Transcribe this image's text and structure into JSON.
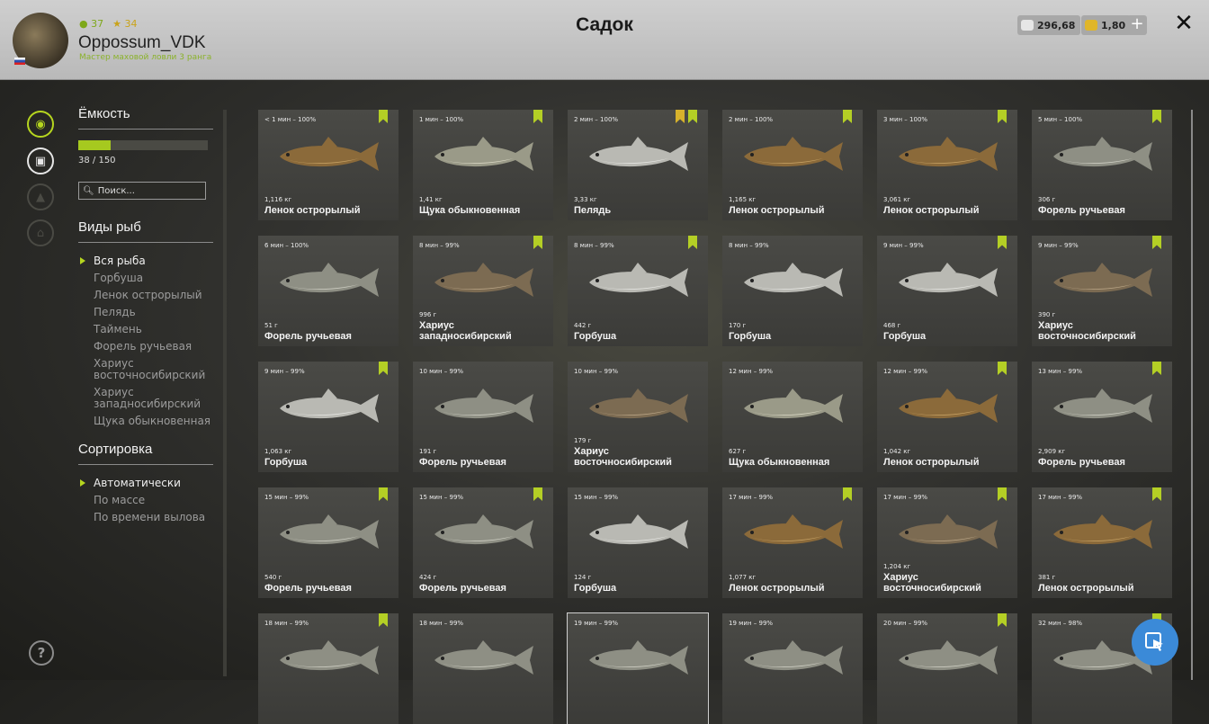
{
  "header": {
    "title": "Садок",
    "username": "Oppossum_VDK",
    "rank_text": "Мастер маховой ловли 3 ранга",
    "level_green": "37",
    "level_gold": "34",
    "silver": "296,68",
    "gold": "1,80",
    "plus_label": "+",
    "close_label": "✕"
  },
  "capacity": {
    "title": "Ёмкость",
    "text": "38 / 150",
    "fraction": 0.2533
  },
  "search": {
    "placeholder": "Поиск..."
  },
  "species": {
    "title": "Виды рыб",
    "items": [
      "Вся рыба",
      "Горбуша",
      "Ленок острорылый",
      "Пелядь",
      "Таймень",
      "Форель ручьевая",
      "Хариус восточносибирский",
      "Хариус западносибирский",
      "Щука обыкновенная"
    ]
  },
  "sorting": {
    "title": "Сортировка",
    "items": [
      "Автоматически",
      "По массе",
      "По времени вылова"
    ]
  },
  "help_label": "?",
  "colors": {
    "accent": "#b6d61f",
    "fab": "#3b8ad8"
  },
  "fish": [
    {
      "time": "< 1 мин – 100%",
      "mass": "1,116 кг",
      "name": "Ленок острорылый",
      "tags": 1
    },
    {
      "time": "1 мин – 100%",
      "mass": "1,41 кг",
      "name": "Щука обыкновенная",
      "tags": 1
    },
    {
      "time": "2 мин – 100%",
      "mass": "3,33 кг",
      "name": "Пелядь",
      "tags": 2
    },
    {
      "time": "2 мин – 100%",
      "mass": "1,165 кг",
      "name": "Ленок острорылый",
      "tags": 1
    },
    {
      "time": "3 мин – 100%",
      "mass": "3,061 кг",
      "name": "Ленок острорылый",
      "tags": 1
    },
    {
      "time": "5 мин – 100%",
      "mass": "306 г",
      "name": "Форель ручьевая",
      "tags": 1
    },
    {
      "time": "6 мин – 100%",
      "mass": "51 г",
      "name": "Форель ручьевая",
      "tags": 0
    },
    {
      "time": "8 мин – 99%",
      "mass": "996 г",
      "name": "Хариус западносибирский",
      "tags": 1
    },
    {
      "time": "8 мин – 99%",
      "mass": "442 г",
      "name": "Горбуша",
      "tags": 1
    },
    {
      "time": "8 мин – 99%",
      "mass": "170 г",
      "name": "Горбуша",
      "tags": 0
    },
    {
      "time": "9 мин – 99%",
      "mass": "468 г",
      "name": "Горбуша",
      "tags": 1
    },
    {
      "time": "9 мин – 99%",
      "mass": "390 г",
      "name": "Хариус восточносибирский",
      "tags": 1
    },
    {
      "time": "9 мин – 99%",
      "mass": "1,063 кг",
      "name": "Горбуша",
      "tags": 1
    },
    {
      "time": "10 мин – 99%",
      "mass": "191 г",
      "name": "Форель ручьевая",
      "tags": 0
    },
    {
      "time": "10 мин – 99%",
      "mass": "179 г",
      "name": "Хариус восточносибирский",
      "tags": 0
    },
    {
      "time": "12 мин – 99%",
      "mass": "627 г",
      "name": "Щука обыкновенная",
      "tags": 0
    },
    {
      "time": "12 мин – 99%",
      "mass": "1,042 кг",
      "name": "Ленок острорылый",
      "tags": 1
    },
    {
      "time": "13 мин – 99%",
      "mass": "2,909 кг",
      "name": "Форель ручьевая",
      "tags": 1
    },
    {
      "time": "15 мин – 99%",
      "mass": "540 г",
      "name": "Форель ручьевая",
      "tags": 1
    },
    {
      "time": "15 мин – 99%",
      "mass": "424 г",
      "name": "Форель ручьевая",
      "tags": 1
    },
    {
      "time": "15 мин – 99%",
      "mass": "124 г",
      "name": "Горбуша",
      "tags": 0
    },
    {
      "time": "17 мин – 99%",
      "mass": "1,077 кг",
      "name": "Ленок острорылый",
      "tags": 1
    },
    {
      "time": "17 мин – 99%",
      "mass": "1,204 кг",
      "name": "Хариус восточносибирский",
      "tags": 1
    },
    {
      "time": "17 мин – 99%",
      "mass": "381 г",
      "name": "Ленок острорылый",
      "tags": 1
    },
    {
      "time": "18 мин – 99%",
      "mass": "",
      "name": "",
      "tags": 1
    },
    {
      "time": "18 мин – 99%",
      "mass": "",
      "name": "",
      "tags": 0
    },
    {
      "time": "19 мин – 99%",
      "mass": "",
      "name": "",
      "tags": 0
    },
    {
      "time": "19 мин – 99%",
      "mass": "",
      "name": "",
      "tags": 0
    },
    {
      "time": "20 мин – 99%",
      "mass": "",
      "name": "",
      "tags": 1
    },
    {
      "time": "32 мин – 98%",
      "mass": "",
      "name": "",
      "tags": 1
    }
  ]
}
